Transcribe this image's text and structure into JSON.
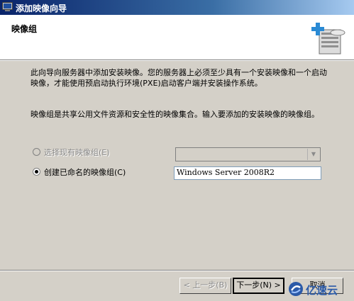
{
  "window": {
    "title": "添加映像向导"
  },
  "header": {
    "heading": "映像组"
  },
  "body": {
    "paragraph1": "此向导向服务器中添加安装映像。您的服务器上必须至少具有一个安装映像和一个启动映像，才能使用预启动执行环境(PXE)启动客户端并安装操作系统。",
    "paragraph2": "映像组是共享公用文件资源和安全性的映像集合。输入要添加的安装映像的映像组。"
  },
  "options": {
    "existing_label": "选择现有映像组(E)",
    "existing_selected": false,
    "existing_enabled": false,
    "create_label": "创建已命名的映像组(C)",
    "create_selected": true,
    "group_name_value": "Windows Server 2008R2"
  },
  "buttons": {
    "back": "< 上一步(B)",
    "next": "下一步(N) >",
    "cancel": "取消"
  },
  "watermark": {
    "text": "亿速云"
  }
}
